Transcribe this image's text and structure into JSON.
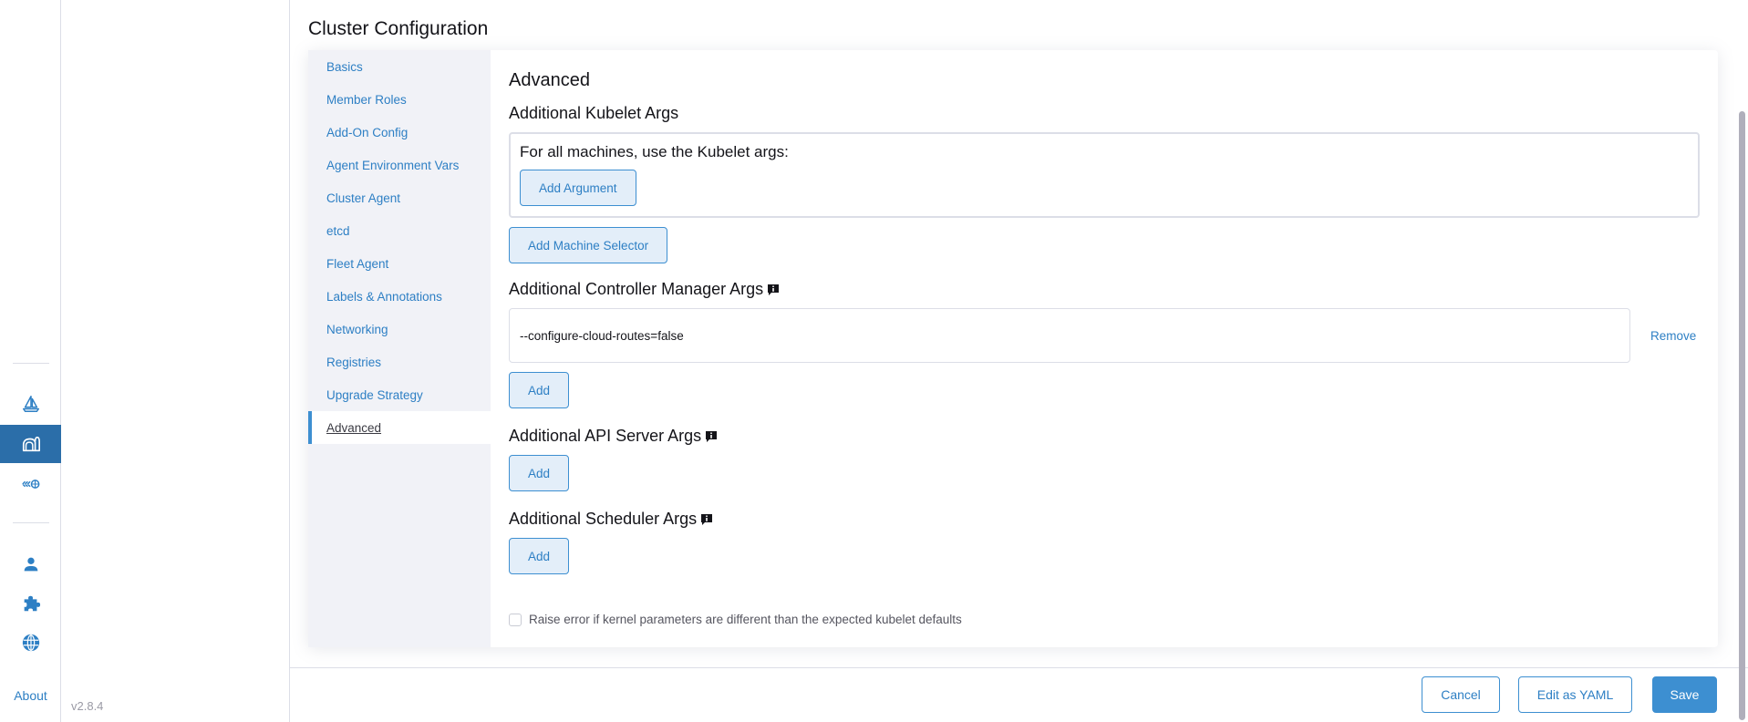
{
  "rail": {
    "items": [
      {
        "icon": "sailboat-icon",
        "label": "Fleet"
      },
      {
        "icon": "cluster-management-icon",
        "label": "Cluster Management",
        "active": true
      },
      {
        "icon": "network-icon",
        "label": "Virtualization"
      },
      {
        "icon": "user-icon",
        "label": "Users & Authentication"
      },
      {
        "icon": "extensions-icon",
        "label": "Extensions"
      },
      {
        "icon": "globe-icon",
        "label": "Global Settings"
      }
    ],
    "about_label": "About",
    "version": "v2.8.4"
  },
  "page": {
    "title": "Cluster Configuration"
  },
  "tabs": [
    {
      "label": "Basics"
    },
    {
      "label": "Member Roles"
    },
    {
      "label": "Add-On Config"
    },
    {
      "label": "Agent Environment Vars"
    },
    {
      "label": "Cluster Agent"
    },
    {
      "label": "etcd"
    },
    {
      "label": "Fleet Agent"
    },
    {
      "label": "Labels & Annotations"
    },
    {
      "label": "Networking"
    },
    {
      "label": "Registries"
    },
    {
      "label": "Upgrade Strategy"
    },
    {
      "label": "Advanced",
      "active": true
    }
  ],
  "advanced": {
    "title": "Advanced",
    "kubelet": {
      "title": "Additional Kubelet Args",
      "box_label": "For all machines, use the Kubelet args:",
      "add_argument_label": "Add Argument",
      "add_machine_selector_label": "Add Machine Selector"
    },
    "controller_manager": {
      "title": "Additional Controller Manager Args",
      "args": [
        "--configure-cloud-routes=false"
      ],
      "remove_label": "Remove",
      "add_label": "Add"
    },
    "api_server": {
      "title": "Additional API Server Args",
      "add_label": "Add"
    },
    "scheduler": {
      "title": "Additional Scheduler Args",
      "add_label": "Add"
    },
    "kernel_check": {
      "label": "Raise error if kernel parameters are different than the expected kubelet defaults",
      "checked": false
    }
  },
  "footer": {
    "cancel_label": "Cancel",
    "edit_yaml_label": "Edit as YAML",
    "save_label": "Save"
  },
  "colors": {
    "accent": "#3d8fd1",
    "rail_active": "#2b6ea9",
    "link": "#2d7fc4"
  }
}
